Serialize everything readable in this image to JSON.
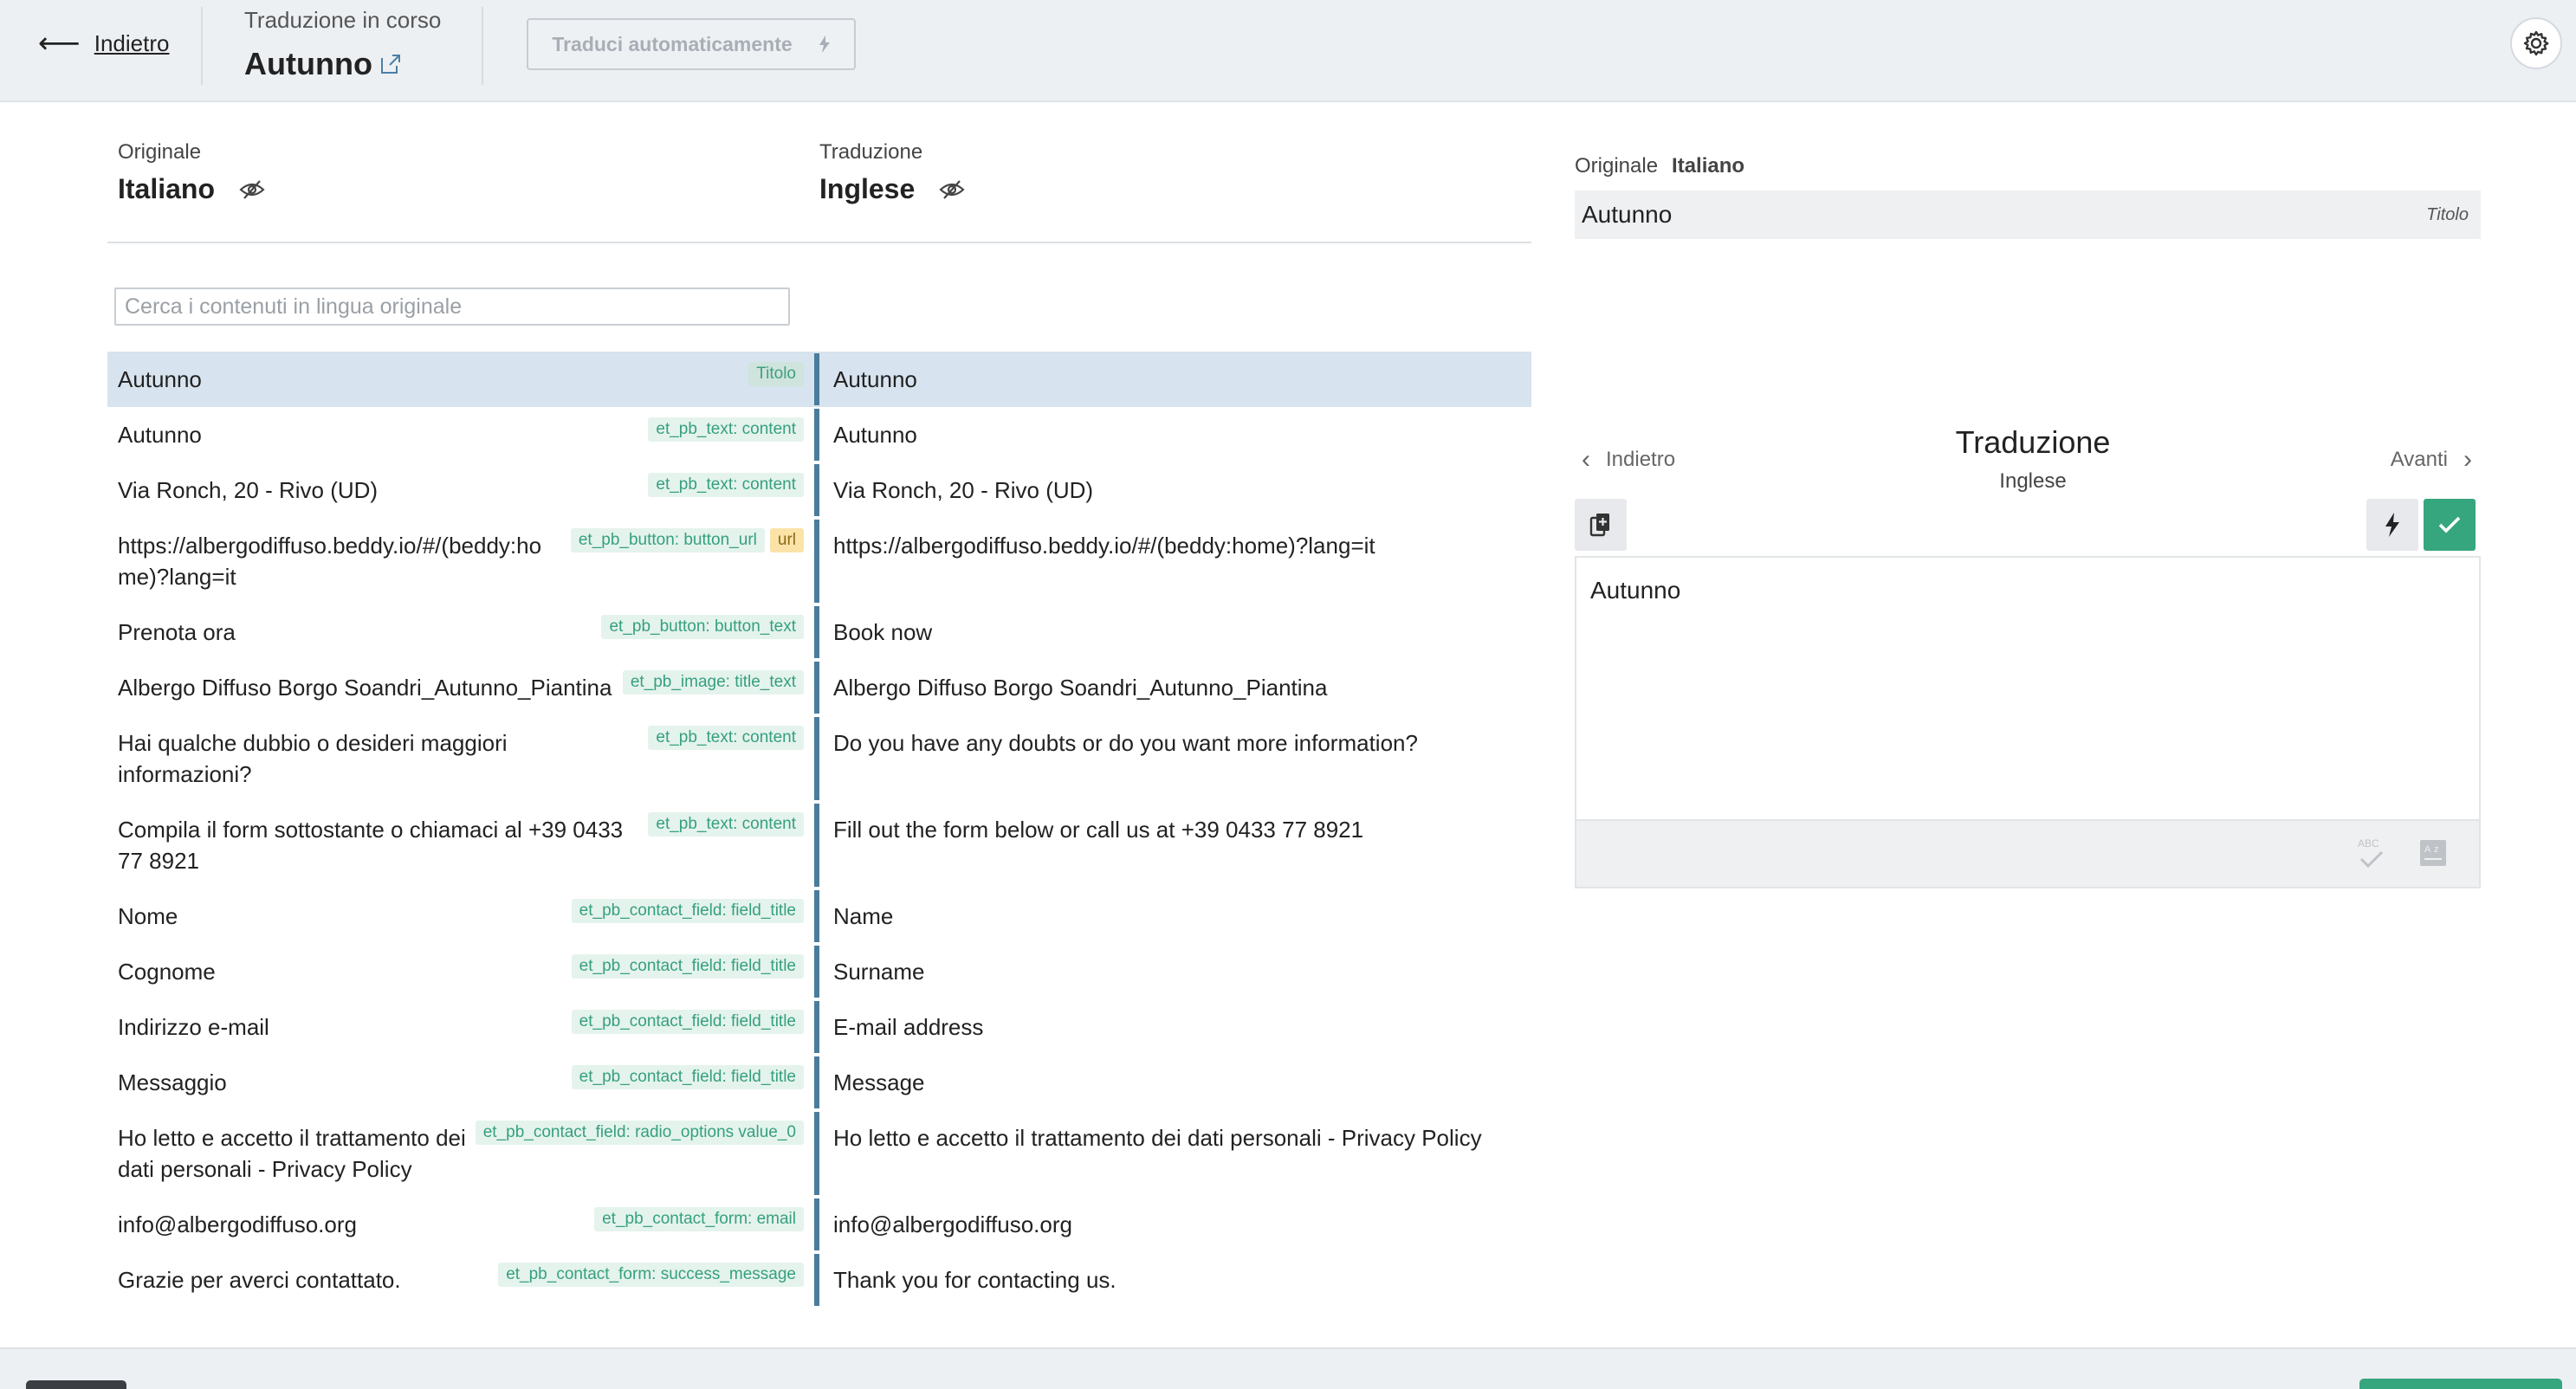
{
  "header": {
    "back_label": "Indietro",
    "status_label": "Traduzione in corso",
    "post_title": "Autunno",
    "auto_translate_label": "Traduci automaticamente"
  },
  "languages": {
    "original_caption": "Originale",
    "original_name": "Italiano",
    "translation_caption": "Traduzione",
    "translation_name": "Inglese"
  },
  "search": {
    "placeholder": "Cerca i contenuti in lingua originale",
    "value": ""
  },
  "rows": [
    {
      "src": "Autunno",
      "tags": [
        "Titolo"
      ],
      "dst": "Autunno",
      "selected": true
    },
    {
      "src": "Autunno",
      "tags": [
        "et_pb_text: content"
      ],
      "dst": "Autunno"
    },
    {
      "src": "Via Ronch, 20 - Rivo (UD)",
      "tags": [
        "et_pb_text: content"
      ],
      "dst": "Via Ronch, 20 - Rivo (UD)"
    },
    {
      "src": "https://albergodiffuso.beddy.io/#/(beddy:ho me)?lang=it",
      "tags": [
        "et_pb_button: button_url",
        "url"
      ],
      "dst": "https://albergodiffuso.beddy.io/#/(beddy:home)?lang=it"
    },
    {
      "src": "Prenota ora",
      "tags": [
        "et_pb_button: button_text"
      ],
      "dst": "Book now"
    },
    {
      "src": "Albergo Diffuso Borgo Soandri_Autunno_Piantina",
      "tags": [
        "et_pb_image: title_text"
      ],
      "dst": "Albergo Diffuso Borgo Soandri_Autunno_Piantina"
    },
    {
      "src": "Hai qualche dubbio o desideri maggiori informazioni?",
      "tags": [
        "et_pb_text: content"
      ],
      "dst": "Do you have any doubts or do you want more information?"
    },
    {
      "src": "Compila il form sottostante o chiamaci al +39 0433 77 8921",
      "tags": [
        "et_pb_text: content"
      ],
      "dst": "Fill out the form below or call us at +39 0433 77 8921"
    },
    {
      "src": "Nome",
      "tags": [
        "et_pb_contact_field: field_title"
      ],
      "dst": "Name"
    },
    {
      "src": "Cognome",
      "tags": [
        "et_pb_contact_field: field_title"
      ],
      "dst": "Surname"
    },
    {
      "src": "Indirizzo e-mail",
      "tags": [
        "et_pb_contact_field: field_title"
      ],
      "dst": "E-mail address"
    },
    {
      "src": "Messaggio",
      "tags": [
        "et_pb_contact_field: field_title"
      ],
      "dst": "Message"
    },
    {
      "src": "Ho letto e accetto il trattamento dei dati personali - Privacy Policy",
      "tags": [
        "et_pb_contact_field: radio_options value_0"
      ],
      "dst": "Ho letto e accetto il trattamento dei dati personali - Privacy Policy"
    },
    {
      "src": "info@albergodiffuso.org",
      "tags": [
        "et_pb_contact_form: email"
      ],
      "dst": "info@albergodiffuso.org"
    },
    {
      "src": "Grazie per averci contattato.",
      "tags": [
        "et_pb_contact_form: success_message"
      ],
      "dst": "Thank you for contacting us."
    }
  ],
  "editor_panel": {
    "original_caption": "Originale",
    "original_lang": "Italiano",
    "original_text": "Autunno",
    "field_type": "Titolo",
    "prev_label": "Indietro",
    "next_label": "Avanti",
    "title": "Traduzione",
    "target_lang": "Inglese",
    "translation_value": "Autunno"
  },
  "colors": {
    "accent_green": "#36a67f",
    "selected_row": "#d7e3ee",
    "divider_blue": "#4a7c9b",
    "tag_bg": "#e5f3ed",
    "tag_text": "#35a07f",
    "url_tag_bg": "#fbe3a8"
  },
  "icons": {
    "back": "arrow-left-icon",
    "external_link": "external-link-icon",
    "auto_translate": "bolt-icon",
    "settings": "gear-icon",
    "visibility": "eye-slash-icon",
    "copy": "copy-icon",
    "confirm": "check-icon",
    "spellcheck": "spellcheck-icon",
    "format": "text-format-icon"
  }
}
